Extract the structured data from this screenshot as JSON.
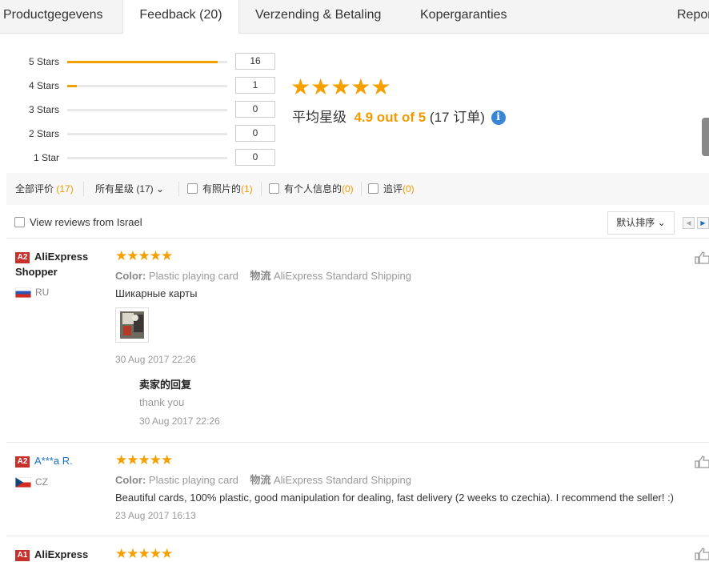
{
  "tabs": [
    {
      "label": "Productgegevens"
    },
    {
      "label": "Feedback (20)"
    },
    {
      "label": "Verzending & Betaling"
    },
    {
      "label": "Kopergaranties"
    },
    {
      "label": "Repor"
    }
  ],
  "ratings": [
    {
      "label": "5 Stars",
      "count": "16",
      "fraction": 0.94
    },
    {
      "label": "4 Stars",
      "count": "1",
      "fraction": 0.06
    },
    {
      "label": "3 Stars",
      "count": "0",
      "fraction": 0
    },
    {
      "label": "2 Stars",
      "count": "0",
      "fraction": 0
    },
    {
      "label": "1 Star",
      "count": "0",
      "fraction": 0
    }
  ],
  "summary": {
    "stars": "★★★★★",
    "avg_label": "平均星级",
    "score": "4.9 out of 5",
    "orders": "(17 订单)",
    "info_glyph": "i"
  },
  "filters": {
    "all_label": "全部评价",
    "all_count": "(17)",
    "stars_label": "所有星级 (17)",
    "chevron": "⌄",
    "photos_label": "有照片的",
    "photos_count": "(1)",
    "personal_label": "有个人信息的",
    "personal_count": "(0)",
    "followup_label": "追评",
    "followup_count": "(0)"
  },
  "country_filter": {
    "label": "View reviews from Israel"
  },
  "sort": {
    "label": "默认排序",
    "chevron": "⌄"
  },
  "pager": {
    "prev": "◀",
    "next": "▶"
  },
  "reviews": [
    {
      "badge": "A2",
      "user_line1": "AliExpress",
      "user_line2": "Shopper",
      "country": "RU",
      "stars": "★★★★★",
      "color_label": "Color:",
      "color_value": "Plastic playing card",
      "ship_label": "物流",
      "ship_value": "AliExpress Standard Shipping",
      "text": "Шикарные карты",
      "date": "30 Aug 2017 22:26",
      "reply_title": "卖家的回复",
      "reply_text": "thank you",
      "reply_date": "30 Aug 2017 22:26"
    },
    {
      "badge": "A2",
      "user_line1": "A***a R.",
      "country": "CZ",
      "stars": "★★★★★",
      "color_label": "Color:",
      "color_value": "Plastic playing card",
      "ship_label": "物流",
      "ship_value": "AliExpress Standard Shipping",
      "text": "Beautiful cards, 100% plastic, good manipulation for dealing, fast delivery (2 weeks to czechia). I recommend the seller! :)",
      "date": "23 Aug 2017 16:13"
    },
    {
      "badge": "A1",
      "user_line1": "AliExpress",
      "stars": "★★★★★"
    }
  ],
  "colors": {
    "accent": "#f29b00",
    "star": "#f5a000",
    "link": "#1a6ec2",
    "badge": "#c9302c"
  }
}
